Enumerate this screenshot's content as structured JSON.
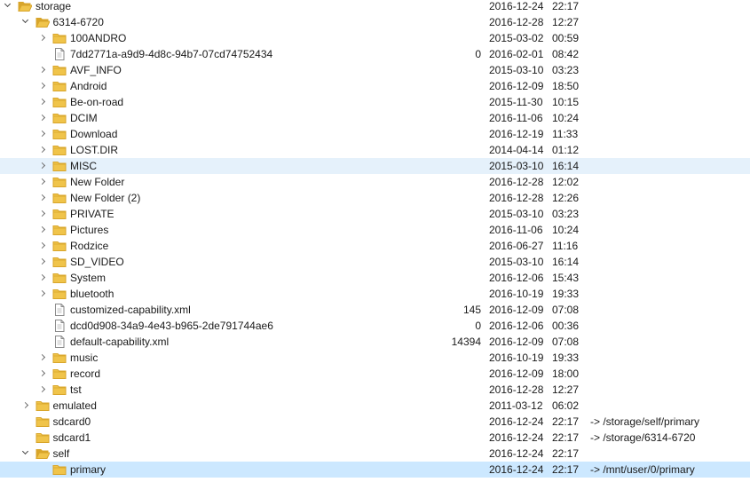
{
  "tree": [
    {
      "depth": 0,
      "twisty": "exp",
      "icon": "folder-open-icon",
      "name": "storage",
      "size": "",
      "date": "2016-12-24",
      "time": "22:17",
      "link": ""
    },
    {
      "depth": 1,
      "twisty": "exp",
      "icon": "folder-open-icon",
      "name": "6314-6720",
      "size": "",
      "date": "2016-12-28",
      "time": "12:27",
      "link": ""
    },
    {
      "depth": 2,
      "twisty": "col",
      "icon": "folder-icon",
      "name": "100ANDRO",
      "size": "",
      "date": "2015-03-02",
      "time": "00:59",
      "link": ""
    },
    {
      "depth": 2,
      "twisty": "",
      "icon": "file-icon",
      "name": "7dd2771a-a9d9-4d8c-94b7-07cd74752434",
      "size": "0",
      "date": "2016-02-01",
      "time": "08:42",
      "link": ""
    },
    {
      "depth": 2,
      "twisty": "col",
      "icon": "folder-icon",
      "name": "AVF_INFO",
      "size": "",
      "date": "2015-03-10",
      "time": "03:23",
      "link": ""
    },
    {
      "depth": 2,
      "twisty": "col",
      "icon": "folder-icon",
      "name": "Android",
      "size": "",
      "date": "2016-12-09",
      "time": "18:50",
      "link": ""
    },
    {
      "depth": 2,
      "twisty": "col",
      "icon": "folder-icon",
      "name": "Be-on-road",
      "size": "",
      "date": "2015-11-30",
      "time": "10:15",
      "link": ""
    },
    {
      "depth": 2,
      "twisty": "col",
      "icon": "folder-icon",
      "name": "DCIM",
      "size": "",
      "date": "2016-11-06",
      "time": "10:24",
      "link": ""
    },
    {
      "depth": 2,
      "twisty": "col",
      "icon": "folder-icon",
      "name": "Download",
      "size": "",
      "date": "2016-12-19",
      "time": "11:33",
      "link": ""
    },
    {
      "depth": 2,
      "twisty": "col",
      "icon": "folder-icon",
      "name": "LOST.DIR",
      "size": "",
      "date": "2014-04-14",
      "time": "01:12",
      "link": ""
    },
    {
      "depth": 2,
      "twisty": "col",
      "icon": "folder-icon",
      "name": "MISC",
      "size": "",
      "date": "2015-03-10",
      "time": "16:14",
      "link": "",
      "state": "hover"
    },
    {
      "depth": 2,
      "twisty": "col",
      "icon": "folder-icon",
      "name": "New Folder",
      "size": "",
      "date": "2016-12-28",
      "time": "12:02",
      "link": ""
    },
    {
      "depth": 2,
      "twisty": "col",
      "icon": "folder-icon",
      "name": "New Folder (2)",
      "size": "",
      "date": "2016-12-28",
      "time": "12:26",
      "link": ""
    },
    {
      "depth": 2,
      "twisty": "col",
      "icon": "folder-icon",
      "name": "PRIVATE",
      "size": "",
      "date": "2015-03-10",
      "time": "03:23",
      "link": ""
    },
    {
      "depth": 2,
      "twisty": "col",
      "icon": "folder-icon",
      "name": "Pictures",
      "size": "",
      "date": "2016-11-06",
      "time": "10:24",
      "link": ""
    },
    {
      "depth": 2,
      "twisty": "col",
      "icon": "folder-icon",
      "name": "Rodzice",
      "size": "",
      "date": "2016-06-27",
      "time": "11:16",
      "link": ""
    },
    {
      "depth": 2,
      "twisty": "col",
      "icon": "folder-icon",
      "name": "SD_VIDEO",
      "size": "",
      "date": "2015-03-10",
      "time": "16:14",
      "link": ""
    },
    {
      "depth": 2,
      "twisty": "col",
      "icon": "folder-icon",
      "name": "System",
      "size": "",
      "date": "2016-12-06",
      "time": "15:43",
      "link": ""
    },
    {
      "depth": 2,
      "twisty": "col",
      "icon": "folder-icon",
      "name": "bluetooth",
      "size": "",
      "date": "2016-10-19",
      "time": "19:33",
      "link": ""
    },
    {
      "depth": 2,
      "twisty": "",
      "icon": "file-icon",
      "name": "customized-capability.xml",
      "size": "145",
      "date": "2016-12-09",
      "time": "07:08",
      "link": ""
    },
    {
      "depth": 2,
      "twisty": "",
      "icon": "file-icon",
      "name": "dcd0d908-34a9-4e43-b965-2de791744ae6",
      "size": "0",
      "date": "2016-12-06",
      "time": "00:36",
      "link": ""
    },
    {
      "depth": 2,
      "twisty": "",
      "icon": "file-icon",
      "name": "default-capability.xml",
      "size": "14394",
      "date": "2016-12-09",
      "time": "07:08",
      "link": ""
    },
    {
      "depth": 2,
      "twisty": "col",
      "icon": "folder-icon",
      "name": "music",
      "size": "",
      "date": "2016-10-19",
      "time": "19:33",
      "link": ""
    },
    {
      "depth": 2,
      "twisty": "col",
      "icon": "folder-icon",
      "name": "record",
      "size": "",
      "date": "2016-12-09",
      "time": "18:00",
      "link": ""
    },
    {
      "depth": 2,
      "twisty": "col",
      "icon": "folder-icon",
      "name": "tst",
      "size": "",
      "date": "2016-12-28",
      "time": "12:27",
      "link": ""
    },
    {
      "depth": 1,
      "twisty": "col",
      "icon": "folder-icon",
      "name": "emulated",
      "size": "",
      "date": "2011-03-12",
      "time": "06:02",
      "link": ""
    },
    {
      "depth": 1,
      "twisty": "",
      "icon": "folder-link-icon",
      "name": "sdcard0",
      "size": "",
      "date": "2016-12-24",
      "time": "22:17",
      "link": "-> /storage/self/primary"
    },
    {
      "depth": 1,
      "twisty": "",
      "icon": "folder-link-icon",
      "name": "sdcard1",
      "size": "",
      "date": "2016-12-24",
      "time": "22:17",
      "link": "-> /storage/6314-6720"
    },
    {
      "depth": 1,
      "twisty": "exp",
      "icon": "folder-open-icon",
      "name": "self",
      "size": "",
      "date": "2016-12-24",
      "time": "22:17",
      "link": ""
    },
    {
      "depth": 2,
      "twisty": "",
      "icon": "folder-link-icon",
      "name": "primary",
      "size": "",
      "date": "2016-12-24",
      "time": "22:17",
      "link": "-> /mnt/user/0/primary",
      "state": "sel"
    }
  ],
  "colors": {
    "folder": "#f0c44a",
    "folder_dark": "#d8a52a",
    "hover": "#e5f1fb",
    "selected": "#cce8ff"
  }
}
